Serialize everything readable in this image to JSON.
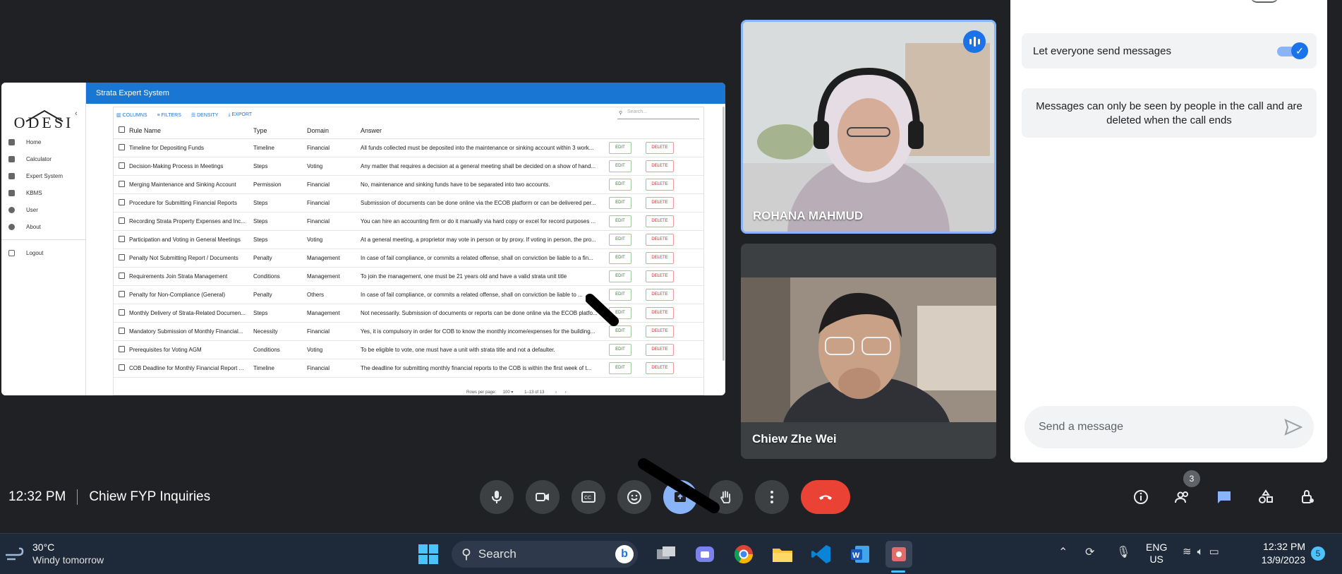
{
  "share": {
    "app_title": "Strata Expert System",
    "logo_text": "ODESI",
    "nav": [
      {
        "label": "Home",
        "icon": "grid-icon"
      },
      {
        "label": "Calculator",
        "icon": "calculator-icon"
      },
      {
        "label": "Expert System",
        "icon": "chat-icon"
      },
      {
        "label": "KBMS",
        "icon": "folder-icon"
      },
      {
        "label": "User",
        "icon": "user-icon"
      },
      {
        "label": "About",
        "icon": "info-icon"
      }
    ],
    "logout": "Logout",
    "toolbar": {
      "columns": "COLUMNS",
      "filters": "FILTERS",
      "density": "DENSITY",
      "export": "EXPORT",
      "search_placeholder": "Search..."
    },
    "headers": [
      "Rule Name",
      "Type",
      "Domain",
      "Answer"
    ],
    "edit_label": "EDIT",
    "delete_label": "DELETE",
    "rows": [
      [
        "Timeline for Depositing Funds",
        "Timeline",
        "Financial",
        "All funds collected must be deposited into the maintenance or sinking account within 3 work..."
      ],
      [
        "Decision-Making Process in Meetings",
        "Steps",
        "Voting",
        "Any matter that requires a decision at a general meeting shall be decided on a show of hand..."
      ],
      [
        "Merging Maintenance and Sinking Account",
        "Permission",
        "Financial",
        "No, maintenance and sinking funds have to be separated into two accounts."
      ],
      [
        "Procedure for Submitting Financial Reports",
        "Steps",
        "Financial",
        "Submission of documents can be done online via the ECOB platform or can be delivered per..."
      ],
      [
        "Recording Strata Property Expenses and Inc...",
        "Steps",
        "Financial",
        "You can hire an accounting firm or do it manually via hard copy or excel for record purposes ..."
      ],
      [
        "Participation and Voting in General Meetings",
        "Steps",
        "Voting",
        "At a general meeting, a proprietor may vote in person or by proxy. If voting in person, the pro..."
      ],
      [
        "Penalty Not Submitting Report / Documents",
        "Penalty",
        "Management",
        "In case of fail compliance, or commits a related offense, shall on conviction be liable to a fin..."
      ],
      [
        "Requirements Join Strata Management",
        "Conditions",
        "Management",
        "To join the management, one must be 21 years old and have a valid strata unit title"
      ],
      [
        "Penalty for Non-Compliance (General)",
        "Penalty",
        "Others",
        "In case of fail compliance, or commits a related offense, shall on conviction be liable to ..."
      ],
      [
        "Monthly Delivery of Strata-Related Documen...",
        "Steps",
        "Management",
        "Not necessarily. Submission of documents or reports can be done online via the ECOB platfo..."
      ],
      [
        "Mandatory Submission of Monthly Financial...",
        "Necessity",
        "Financial",
        "Yes, it is compulsory in order for COB to know the monthly income/expenses for the building..."
      ],
      [
        "Prerequisites for Voting AGM",
        "Conditions",
        "Voting",
        "To be eligible to vote, one must have a unit with strata title and not a defaulter."
      ],
      [
        "COB Deadline for Monthly Financial Report ...",
        "Timeline",
        "Financial",
        "The deadline for submitting monthly financial reports to the COB is within the first week of t..."
      ]
    ],
    "pagination": {
      "rows_per_page_label": "Rows per page:",
      "rows_per_page": "100",
      "range": "1–13 of 13"
    }
  },
  "participants": [
    {
      "name": "ROHANA MAHMUD",
      "speaking": true
    },
    {
      "name": "Chiew Zhe Wei",
      "speaking": false
    }
  ],
  "chat": {
    "toggle_label": "Let everyone send messages",
    "toggle_on": true,
    "note": "Messages can only be seen by people in the call and are deleted when the call ends",
    "input_placeholder": "Send a message"
  },
  "meeting": {
    "time": "12:32 PM",
    "title": "Chiew FYP Inquiries",
    "people_count": "3"
  },
  "colors": {
    "accent": "#8ab4f8",
    "end_call": "#ea4335",
    "bg": "#202124"
  },
  "taskbar": {
    "weather_temp": "30°C",
    "weather_desc": "Windy tomorrow",
    "search_label": "Search",
    "lang_top": "ENG",
    "lang_bottom": "US",
    "clock_time": "12:32 PM",
    "clock_date": "13/9/2023",
    "notif_count": "5"
  }
}
